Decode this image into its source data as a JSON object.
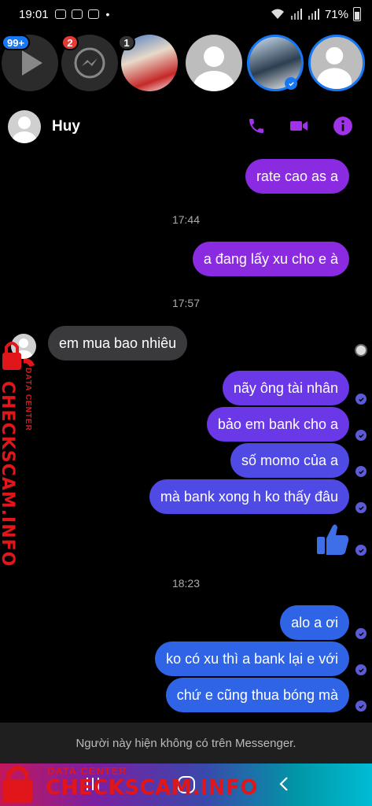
{
  "status_bar": {
    "time": "19:01",
    "dot": "•",
    "battery": "71%"
  },
  "chat_heads": {
    "badges": [
      "99+",
      "2",
      "1"
    ]
  },
  "chat": {
    "contact_name": "Huy",
    "messages": [
      {
        "text": "rate cao as a",
        "side": "right"
      },
      {
        "text": "a đang lấy xu cho e à",
        "side": "right"
      },
      {
        "text": "em mua bao nhiêu",
        "side": "left"
      },
      {
        "text": "nãy ông tài nhân",
        "side": "right"
      },
      {
        "text": "bảo em bank cho a",
        "side": "right"
      },
      {
        "text": "số momo của a",
        "side": "right"
      },
      {
        "text": "mà bank xong h ko thấy đâu",
        "side": "right"
      },
      {
        "text": "alo a ơi",
        "side": "right"
      },
      {
        "text": "ko có xu thì a bank lại e với",
        "side": "right"
      },
      {
        "text": "chứ e cũng thua bóng mà",
        "side": "right"
      }
    ],
    "time_separators": [
      "17:44",
      "17:57",
      "18:23"
    ],
    "footer_note": "Người này hiện không có trên Messenger."
  },
  "watermark": {
    "top_text": "DATA CENTER",
    "main_text": "CHECKSCAM.INFO"
  },
  "colors": {
    "purple": "#8a2be2",
    "blue": "#2f64e6",
    "accent_icons": "#a033e8",
    "watermark_red": "#e0161b"
  }
}
